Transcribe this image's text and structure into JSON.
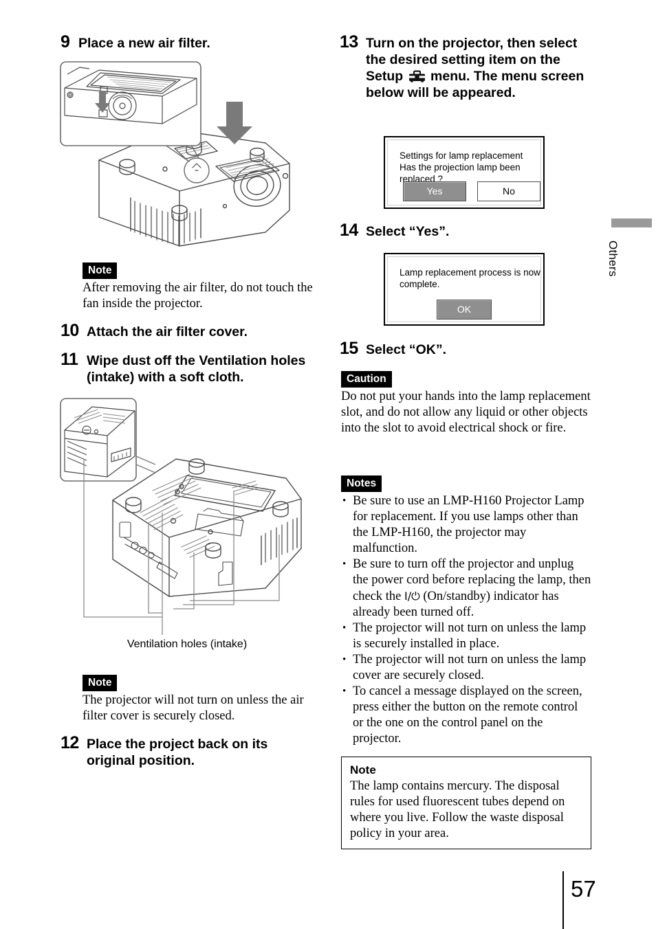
{
  "page": {
    "number": "57",
    "side_tab_label": "Others"
  },
  "left_column": {
    "step9": {
      "number": "9",
      "text": "Place a new air filter."
    },
    "note_after_step9": {
      "tag": "Note",
      "text": "After removing the air filter, do not touch the fan inside the projector."
    },
    "step10": {
      "number": "10",
      "text": "Attach the air filter cover."
    },
    "step11": {
      "number": "11",
      "text": "Wipe dust off the Ventilation holes (intake) with a soft cloth."
    },
    "ventilation_caption": "Ventilation holes (intake)",
    "note_after_step11": {
      "tag": "Note",
      "text": "The projector will not turn on unless the air filter cover is securely closed."
    },
    "step12": {
      "number": "12",
      "text": "Place the project back on its original position."
    }
  },
  "right_column": {
    "step13": {
      "number": "13",
      "text_part1": "Turn on the projector, then select the desired setting item on the Setup ",
      "icon": "toolbox-icon",
      "text_part2": " menu. The menu screen below will be appeared."
    },
    "dialog_lamp_replacement": {
      "line1": "Settings for lamp replacement",
      "line2": "Has the projection lamp been replaced ?",
      "button_yes": "Yes",
      "button_no": "No",
      "selected_button": "Yes",
      "selected_color": "#8f8f8f"
    },
    "step14": {
      "number": "14",
      "text": "Select “Yes”."
    },
    "dialog_lamp_complete": {
      "line1": "Lamp replacement process is now complete.",
      "button_ok": "OK",
      "selected_button": "OK",
      "selected_color": "#8f8f8f"
    },
    "step15": {
      "number": "15",
      "text": "Select “OK”."
    },
    "caution": {
      "tag": "Caution",
      "text": "Do not put your hands into the lamp replacement slot, and do not allow any liquid or other objects into the slot to avoid electrical shock or fire."
    },
    "notes": {
      "tag": "Notes",
      "items": [
        {
          "text_before": "Be sure to use an LMP-H160 Projector Lamp for replacement. If you use lamps other than the LMP-H160, the projector may malfunction.",
          "symbol": "",
          "text_after": ""
        },
        {
          "text_before": "Be sure to turn off the projector and unplug the power cord before replacing the lamp, then check the ",
          "symbol": "I/⏻",
          "text_after": " (On/standby) indicator has already been turned off."
        },
        {
          "text_before": "The projector will not turn on unless the lamp is securely installed in place.",
          "symbol": "",
          "text_after": ""
        },
        {
          "text_before": "The projector will not turn on unless the lamp cover are securely closed.",
          "symbol": "",
          "text_after": ""
        },
        {
          "text_before": "To cancel a message displayed on the screen, press either the button on the remote control or the one on the control panel on the projector.",
          "symbol": "",
          "text_after": ""
        }
      ]
    },
    "note_box": {
      "title": "Note",
      "text": "The lamp contains mercury. The disposal rules for used fluorescent tubes depend on where you live. Follow the waste disposal policy in your area."
    }
  }
}
